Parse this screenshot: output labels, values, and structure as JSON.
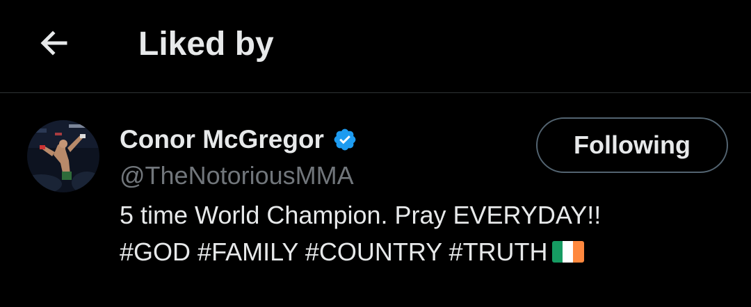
{
  "header": {
    "title": "Liked by",
    "back_icon": "arrow-left-icon"
  },
  "user": {
    "display_name": "Conor McGregor",
    "verified_icon": "verified-badge-icon",
    "handle": "@TheNotoriousMMA",
    "bio_line1": "5 time World Champion. Pray EVERYDAY!!",
    "hashtags": [
      "#GOD",
      "#FAMILY",
      "#COUNTRY",
      "#TRUTH"
    ],
    "flag_emoji": "ireland-flag-icon",
    "follow_button": "Following"
  },
  "colors": {
    "background": "#000000",
    "primary_text": "#e7e9ea",
    "secondary_text": "#71767b",
    "divider": "#2f3336",
    "verified_blue": "#1d9bf0",
    "button_border": "#536471"
  }
}
